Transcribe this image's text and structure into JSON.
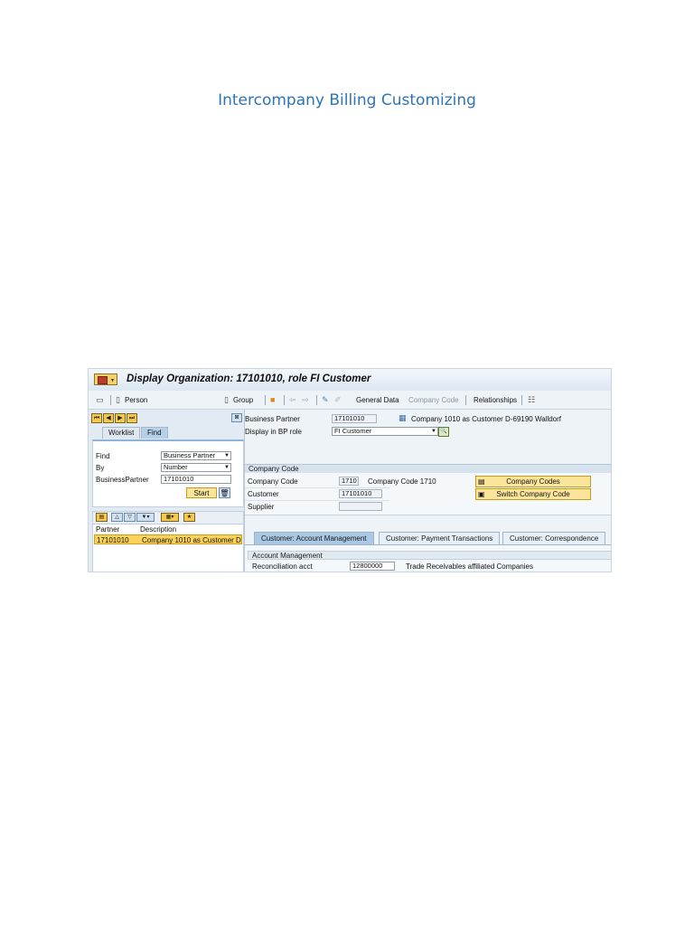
{
  "document": {
    "heading": "Intercompany Billing Customizing"
  },
  "window": {
    "title": "Display Organization: 17101010, role FI Customer"
  },
  "toolbar": {
    "person": "Person",
    "group": "Group",
    "general_data": "General Data",
    "company_code": "Company Code",
    "relationships": "Relationships"
  },
  "left": {
    "tabs": [
      "Worklist",
      "Find"
    ],
    "active_tab": "Find",
    "find_label": "Find",
    "find_value": "Business Partner",
    "by_label": "By",
    "by_value": "Number",
    "bp_label": "BusinessPartner",
    "bp_value": "17101010",
    "start_label": "Start",
    "columns": [
      "Partner",
      "Description"
    ],
    "rows": [
      {
        "partner": "17101010",
        "description": "Company 1010 as Customer D"
      }
    ]
  },
  "header": {
    "bp_label": "Business Partner",
    "bp_value": "17101010",
    "bp_desc": "Company 1010 as Customer D-69190 Walldorf",
    "role_label": "Display in BP role",
    "role_value": "FI Customer"
  },
  "company_code_section": {
    "title": "Company Code",
    "cc_label": "Company Code",
    "cc_value": "1710",
    "cc_desc": "Company Code 1710",
    "customer_label": "Customer",
    "customer_value": "17101010",
    "supplier_label": "Supplier",
    "supplier_value": "",
    "btn_codes": "Company Codes",
    "btn_switch": "Switch Company Code"
  },
  "tabs": [
    "Customer: Account Management",
    "Customer: Payment Transactions",
    "Customer: Correspondence"
  ],
  "active_tab": "Customer: Account Management",
  "account": {
    "title": "Account Management",
    "recon_label": "Reconciliation acct",
    "recon_value": "12800000",
    "recon_desc": "Trade Receivables affiliated Companies"
  }
}
